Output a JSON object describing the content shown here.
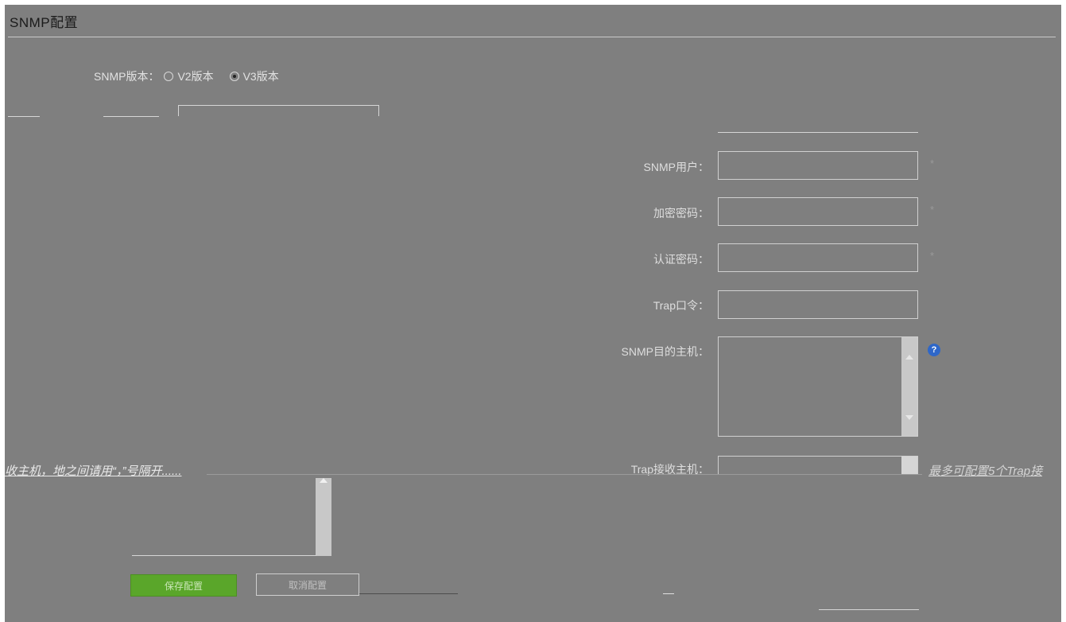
{
  "title": "SNMP配置",
  "version": {
    "label": "SNMP版本：",
    "options": [
      "V2版本",
      "V3版本"
    ],
    "selected": "V3版本"
  },
  "fields": {
    "snmp_user": {
      "label": "SNMP用户：",
      "value": ""
    },
    "encrypt_pwd": {
      "label": "加密密码：",
      "value": ""
    },
    "auth_pwd": {
      "label": "认证密码：",
      "value": ""
    },
    "trap_cmd": {
      "label": "Trap口令：",
      "value": ""
    },
    "dest_host": {
      "label": "SNMP目的主机：",
      "value": ""
    },
    "trap_host": {
      "label": "Trap接收主机：",
      "value": ""
    }
  },
  "required_mark": "*",
  "help_icon": "?",
  "hint_left": "收主机，地之间请用“，”号隔开......",
  "hint_right": "最多可配置5个Trap接",
  "buttons": {
    "save": "保存配置",
    "cancel": "取消配置"
  }
}
